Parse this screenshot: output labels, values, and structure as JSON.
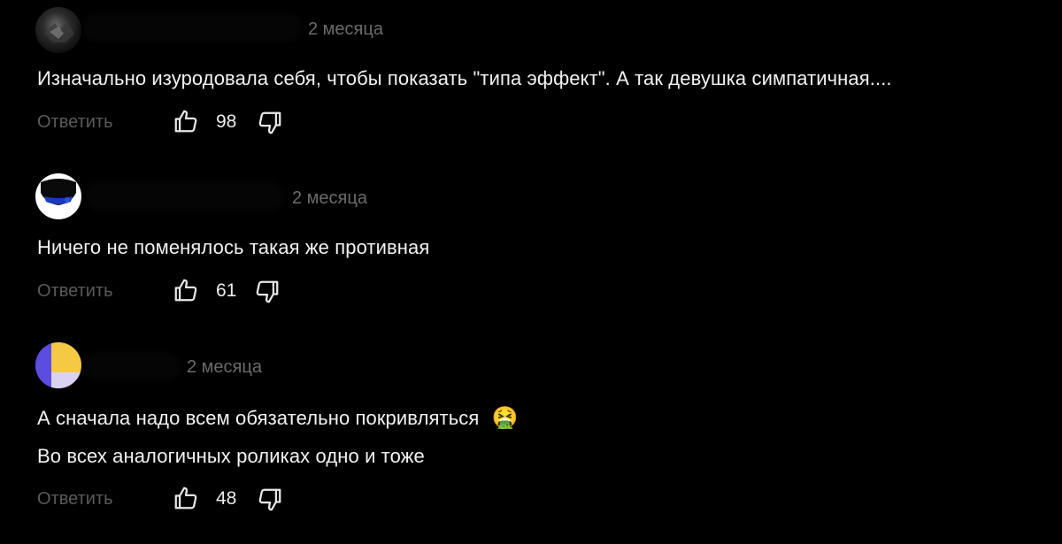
{
  "comments": [
    {
      "time": "2 месяца",
      "lines": [
        "Изначально изуродовала себя, чтобы показать \"типа эффект\". А так девушка симпатичная...."
      ],
      "reply_label": "Ответить",
      "likes": "98"
    },
    {
      "time": "2 месяца",
      "lines": [
        "Ничего не поменялось такая же противная"
      ],
      "reply_label": "Ответить",
      "likes": "61"
    },
    {
      "time": "2 месяца",
      "lines": [
        "А сначала надо всем обязательно покривляться",
        "Во всех аналогичных роликах одно и тоже"
      ],
      "emoji": "🤮",
      "reply_label": "Ответить",
      "likes": "48"
    }
  ],
  "icons": {
    "like": "thumb-up-icon",
    "dislike": "thumb-down-icon"
  },
  "colors": {
    "background": "#000000",
    "text": "#f2f2f2",
    "secondary": "#6b6b6b",
    "avatar3_purple": "#5b4de0",
    "avatar3_yellow": "#f6c945"
  }
}
